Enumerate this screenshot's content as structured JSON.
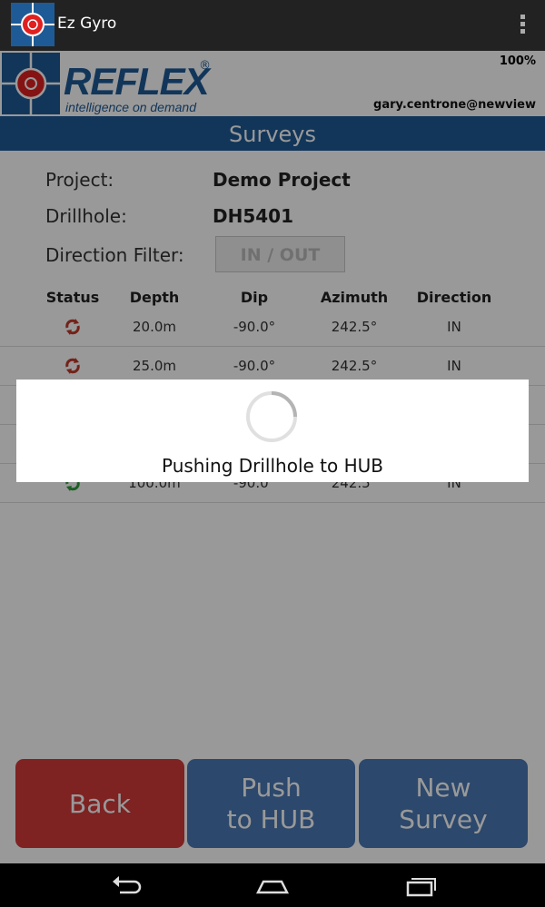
{
  "app": {
    "title": "Ez Gyro"
  },
  "header": {
    "battery": "100%",
    "user_email": "gary.centrone@newview",
    "logo_text": "REFLEX",
    "logo_tagline": "intelligence on demand",
    "logo_mark": "®"
  },
  "page_title": "Surveys",
  "info": {
    "project_label": "Project:",
    "project_value": "Demo Project",
    "drillhole_label": "Drillhole:",
    "drillhole_value": "DH5401",
    "filter_label": "Direction Filter:",
    "filter_value": "IN / OUT"
  },
  "table": {
    "headers": [
      "Status",
      "Depth",
      "Dip",
      "Azimuth",
      "Direction"
    ],
    "rows": [
      {
        "status": "pending",
        "depth": "20.0m",
        "dip": "-90.0°",
        "azimuth": "242.5°",
        "direction": "IN"
      },
      {
        "status": "pending",
        "depth": "25.0m",
        "dip": "-90.0°",
        "azimuth": "242.5°",
        "direction": "IN"
      },
      {
        "status": "pending",
        "depth": "",
        "dip": "",
        "azimuth": "",
        "direction": ""
      },
      {
        "status": "pending",
        "depth": "",
        "dip": "",
        "azimuth": "",
        "direction": ""
      },
      {
        "status": "synced",
        "depth": "100.0m",
        "dip": "-90.0°",
        "azimuth": "242.5°",
        "direction": "IN"
      }
    ]
  },
  "buttons": {
    "back": "Back",
    "push_line1": "Push",
    "push_line2": "to HUB",
    "new_line1": "New",
    "new_line2": "Survey"
  },
  "dialog": {
    "message": "Pushing Drillhole to HUB"
  },
  "colors": {
    "brand_blue": "#1e5b96",
    "status_pending": "#c0392b",
    "status_synced": "#2e9e3a",
    "back_button": "#d33a3a",
    "push_button": "#4a78b4",
    "new_button": "#4a78b4"
  },
  "icons": {
    "app": "crosshair-logo-icon",
    "menu": "overflow-menu-icon",
    "status": "sync-arrows-icon",
    "nav_back": "back-arrow-icon",
    "nav_home": "home-icon",
    "nav_recents": "recents-icon"
  }
}
